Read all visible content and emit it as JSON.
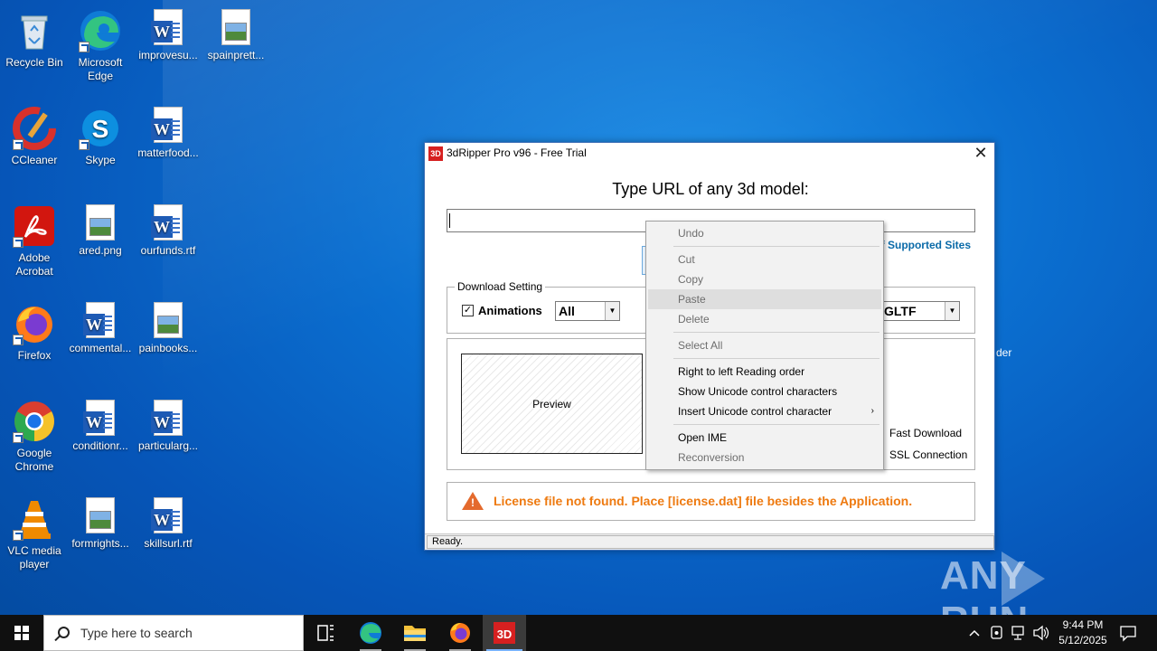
{
  "desktop": {
    "icons": [
      {
        "label": "Recycle Bin",
        "icon": "recycle-bin-icon"
      },
      {
        "label": "Microsoft Edge",
        "icon": "edge-icon"
      },
      {
        "label": "improvesu...",
        "icon": "word-doc-icon"
      },
      {
        "label": "spainprett...",
        "icon": "image-file-icon"
      },
      {
        "label": "CCleaner",
        "icon": "ccleaner-icon"
      },
      {
        "label": "Skype",
        "icon": "skype-icon"
      },
      {
        "label": "matterfood...",
        "icon": "word-doc-icon"
      },
      {
        "label": "Adobe Acrobat",
        "icon": "acrobat-icon"
      },
      {
        "label": "ared.png",
        "icon": "image-file-icon"
      },
      {
        "label": "ourfunds.rtf",
        "icon": "word-doc-icon"
      },
      {
        "label": "Firefox",
        "icon": "firefox-icon"
      },
      {
        "label": "commental...",
        "icon": "word-doc-icon"
      },
      {
        "label": "painbooks...",
        "icon": "image-file-icon"
      },
      {
        "label": "Google Chrome",
        "icon": "chrome-icon"
      },
      {
        "label": "conditionr...",
        "icon": "word-doc-icon"
      },
      {
        "label": "particularg...",
        "icon": "word-doc-icon"
      },
      {
        "label": "VLC media player",
        "icon": "vlc-icon"
      },
      {
        "label": "formrights...",
        "icon": "image-file-icon"
      },
      {
        "label": "skillsurl.rtf",
        "icon": "word-doc-icon"
      }
    ],
    "partial_label_right": "der"
  },
  "window": {
    "title": "3dRipper Pro v96 - Free Trial",
    "logo_text": "3D",
    "close_glyph": "✕",
    "prompt": "Type URL of any 3d model:",
    "url_value": "",
    "supported_sites_link": "f Supported Sites",
    "download_setting": {
      "label": "Download Setting",
      "animations_label": "Animations",
      "animations_checked": true,
      "animations_select": "All",
      "format_select": "GLTF"
    },
    "preview_label": "Preview",
    "options": [
      "Fast Download",
      "SSL Connection"
    ],
    "license_message": "License file not found. Place [license.dat] file besides the Application.",
    "status": "Ready."
  },
  "context_menu": {
    "items": [
      {
        "label": "Undo",
        "disabled": true
      },
      {
        "label": "Cut",
        "disabled": true
      },
      {
        "label": "Copy",
        "disabled": true
      },
      {
        "label": "Paste",
        "disabled": true,
        "hover": true
      },
      {
        "label": "Delete",
        "disabled": true
      },
      {
        "label": "Select All",
        "disabled": true
      },
      {
        "label": "Right to left Reading order",
        "disabled": false
      },
      {
        "label": "Show Unicode control characters",
        "disabled": false
      },
      {
        "label": "Insert Unicode control character",
        "disabled": false,
        "submenu": true
      },
      {
        "label": "Open IME",
        "disabled": false
      },
      {
        "label": "Reconversion",
        "disabled": true
      }
    ]
  },
  "taskbar": {
    "search_placeholder": "Type here to search",
    "apps": [
      "task-view-icon",
      "edge-icon",
      "file-explorer-icon",
      "firefox-icon",
      "3dripper-icon"
    ],
    "clock_time": "9:44 PM",
    "clock_date": "5/12/2025"
  },
  "watermark": {
    "text_left": "ANY",
    "text_right": "RUN"
  },
  "colors": {
    "license_text": "#ee7a10",
    "link_text": "#0a6aa8",
    "desktop_blue": "#0b6fd0"
  }
}
